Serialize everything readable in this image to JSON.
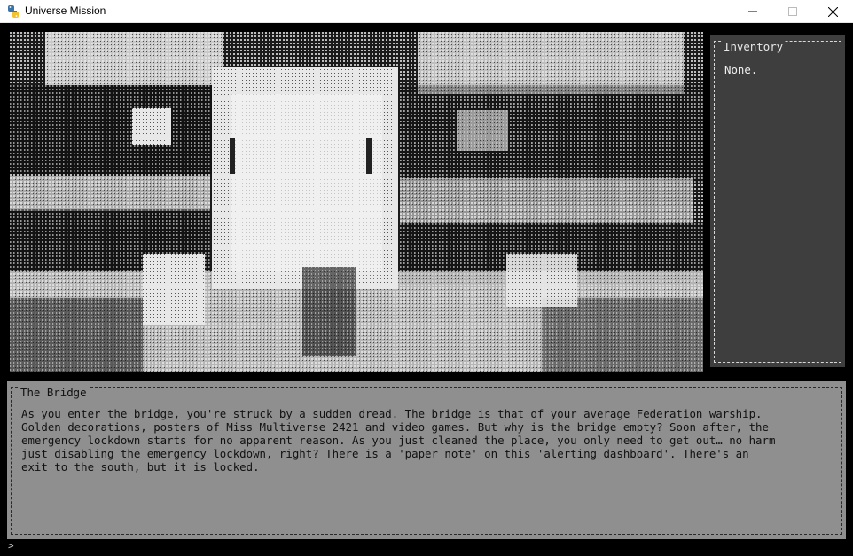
{
  "window": {
    "title": "Universe Mission",
    "minimize_glyph": "—",
    "close_glyph": "✕"
  },
  "scene": {
    "icon": "ascii-art-bridge-scene"
  },
  "inventory": {
    "title": "Inventory",
    "content": "None."
  },
  "room": {
    "title": "The Bridge",
    "description": "As you enter the bridge, you're struck by a sudden dread. The bridge is that of your average Federation warship.\nGolden decorations, posters of Miss Multiverse 2421 and video games. But why is the bridge empty? Soon after, the\nemergency lockdown starts for no apparent reason. As you just cleaned the place, you only need to get out… no harm\njust disabling the emergency lockdown, right? There is a 'paper note' on this 'alerting dashboard'. There's an\nexit to the south, but it is locked."
  },
  "command": {
    "prompt": ">"
  },
  "colors": {
    "inventory_bg": "#3e3e3e",
    "room_bg": "#8f8f8f",
    "window_bg": "#000000"
  }
}
